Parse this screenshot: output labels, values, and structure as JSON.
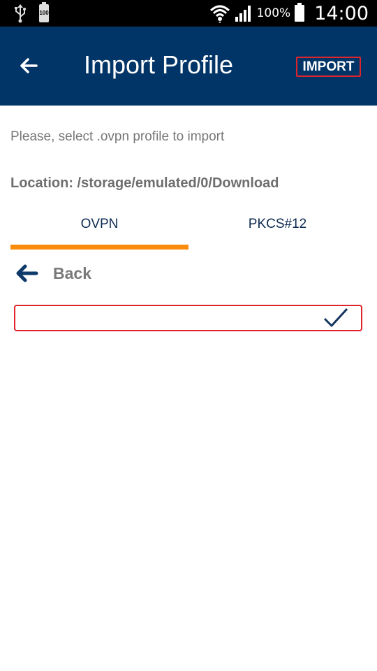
{
  "status_bar": {
    "battery_small_label": "100",
    "battery_percent": "100%",
    "time": "14:00"
  },
  "app_bar": {
    "title": "Import Profile",
    "import_label": "IMPORT"
  },
  "content": {
    "instruction": "Please, select .ovpn profile to import",
    "location": "Location: /storage/emulated/0/Download",
    "tabs": [
      {
        "label": "OVPN",
        "selected": true
      },
      {
        "label": "PKCS#12",
        "selected": false
      }
    ],
    "back_label": "Back",
    "file_row": {
      "checked": true
    }
  },
  "colors": {
    "app_bar": "#023567",
    "accent": "#fb8c0b",
    "highlight_border": "#e0242b",
    "primary_text": "#0d2b52"
  }
}
